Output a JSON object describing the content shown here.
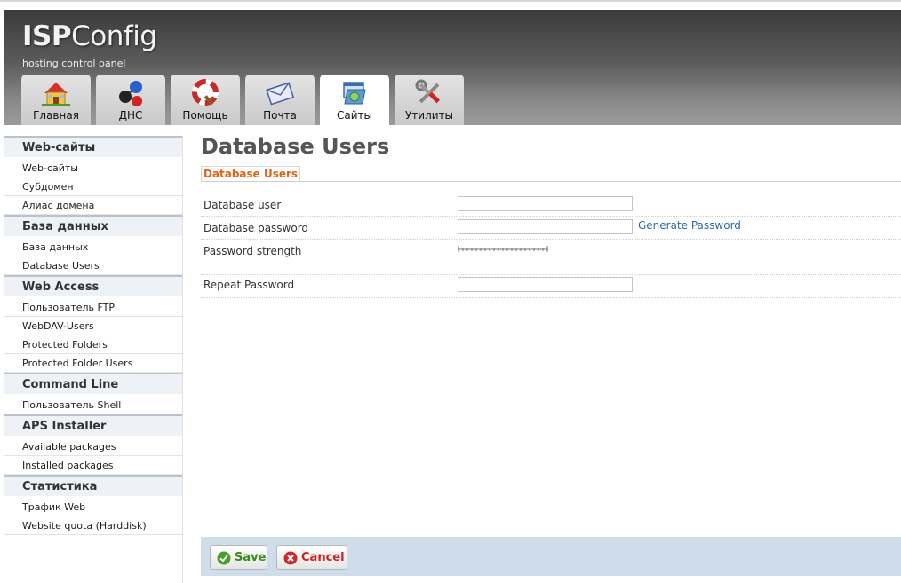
{
  "header": {
    "logo_bold": "ISP",
    "logo_rest": "Config",
    "tagline": "hosting control panel"
  },
  "tabs": [
    {
      "label": "Главная",
      "icon": "home-icon"
    },
    {
      "label": "ДНС",
      "icon": "dns-icon"
    },
    {
      "label": "Помощь",
      "icon": "help-icon"
    },
    {
      "label": "Почта",
      "icon": "mail-icon"
    },
    {
      "label": "Сайты",
      "icon": "sites-icon",
      "active": true
    },
    {
      "label": "Утилиты",
      "icon": "tools-icon"
    }
  ],
  "sidebar": {
    "sections": [
      {
        "title": "Web-сайты",
        "items": [
          "Web-сайты",
          "Субдомен",
          "Алиас домена"
        ]
      },
      {
        "title": "База данных",
        "items": [
          "База данных",
          "Database Users"
        ]
      },
      {
        "title": "Web Access",
        "items": [
          "Пользователь FTP",
          "WebDAV-Users",
          "Protected Folders",
          "Protected Folder Users"
        ]
      },
      {
        "title": "Command Line",
        "items": [
          "Пользователь Shell"
        ]
      },
      {
        "title": "APS Installer",
        "items": [
          "Available packages",
          "Installed packages"
        ]
      },
      {
        "title": "Статистика",
        "items": [
          "Трафик Web",
          "Website quota (Harddisk)"
        ]
      }
    ]
  },
  "main": {
    "title": "Database Users",
    "subtab": "Database Users",
    "fields": {
      "user_label": "Database user",
      "user_value": "",
      "password_label": "Database password",
      "password_value": "",
      "generate_label": "Generate Password",
      "strength_label": "Password strength",
      "strength_level": 0,
      "repeat_label": "Repeat Password",
      "repeat_value": ""
    }
  },
  "buttons": {
    "save": "Save",
    "cancel": "Cancel"
  },
  "colors": {
    "accent_orange": "#e06418",
    "link_blue": "#2d6aa5",
    "button_bar": "#cfdcea",
    "save_green": "#3a8a1e",
    "cancel_red": "#cc2222"
  }
}
